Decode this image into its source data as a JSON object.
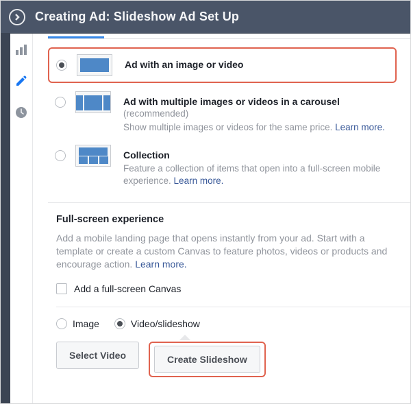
{
  "header": {
    "title": "Creating Ad: Slideshow Ad Set Up"
  },
  "sidebar": {
    "icons": [
      "bar-chart-icon",
      "pencil-icon",
      "clock-icon"
    ]
  },
  "format": {
    "option1": {
      "title": "Ad with an image or video"
    },
    "option2": {
      "title": "Ad with multiple images or videos in a carousel",
      "recommended": "(recommended)",
      "desc": "Show multiple images or videos for the same price. ",
      "learn": "Learn more."
    },
    "option3": {
      "title": "Collection",
      "desc": "Feature a collection of items that open into a full-screen mobile experience. ",
      "learn": "Learn more."
    }
  },
  "fullscreen": {
    "title": "Full-screen experience",
    "desc": "Add a mobile landing page that opens instantly from your ad. Start with a template or create a custom Canvas to feature photos, videos or products and encourage action. ",
    "learn": "Learn more.",
    "checkbox_label": "Add a full-screen Canvas"
  },
  "media": {
    "image_label": "Image",
    "video_label": "Video/slideshow"
  },
  "buttons": {
    "select_video": "Select Video",
    "create_slideshow": "Create Slideshow"
  }
}
